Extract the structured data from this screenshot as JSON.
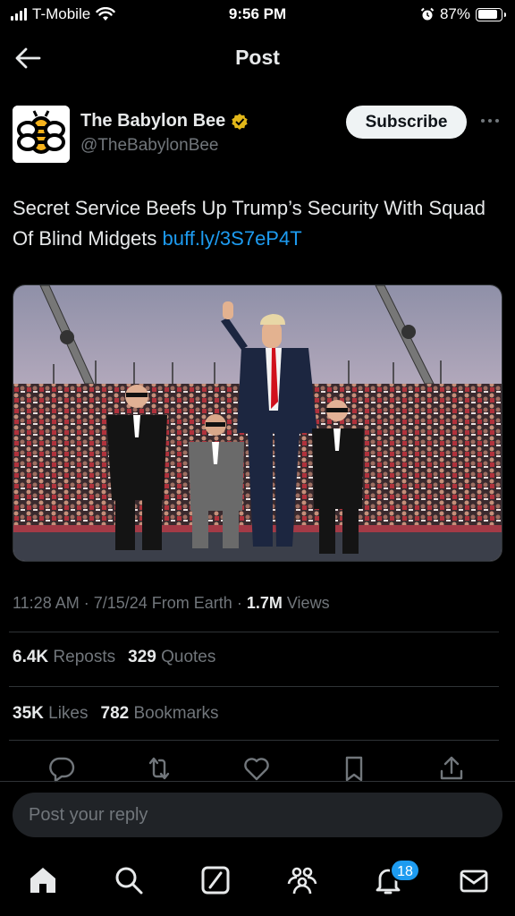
{
  "status_bar": {
    "carrier": "T-Mobile",
    "time": "9:56 PM",
    "battery_pct": "87%",
    "battery_level": 0.87
  },
  "header": {
    "title": "Post",
    "back_icon": "arrow-left-icon"
  },
  "author": {
    "name": "The Babylon Bee",
    "handle": "@TheBabylonBee",
    "verified_icon": "verified-badge-icon",
    "subscribe_label": "Subscribe",
    "more_icon": "more-horizontal-icon"
  },
  "post": {
    "text": "Secret Service Beefs Up Trump’s Security With Squad Of Blind Midgets ",
    "link": "buff.ly/3S7eP4T"
  },
  "meta": {
    "time": "11:28 AM",
    "date": "7/15/24",
    "source": "From Earth",
    "views_count": "1.7M",
    "views_label": "Views"
  },
  "stats": {
    "reposts_count": "6.4K",
    "reposts_label": "Reposts",
    "quotes_count": "329",
    "quotes_label": "Quotes",
    "likes_count": "35K",
    "likes_label": "Likes",
    "bookmarks_count": "782",
    "bookmarks_label": "Bookmarks"
  },
  "actions": [
    "reply-icon",
    "repost-icon",
    "like-icon",
    "bookmark-icon",
    "share-icon"
  ],
  "reply": {
    "placeholder": "Post your reply"
  },
  "tabbar": {
    "items": [
      "home-icon",
      "search-icon",
      "grok-icon",
      "communities-icon",
      "notifications-icon",
      "messages-icon"
    ],
    "notification_badge": "18"
  },
  "colors": {
    "accent": "#1d9bf0",
    "background": "#000000",
    "muted": "#71767b",
    "verified_gold": "#e2b719"
  }
}
